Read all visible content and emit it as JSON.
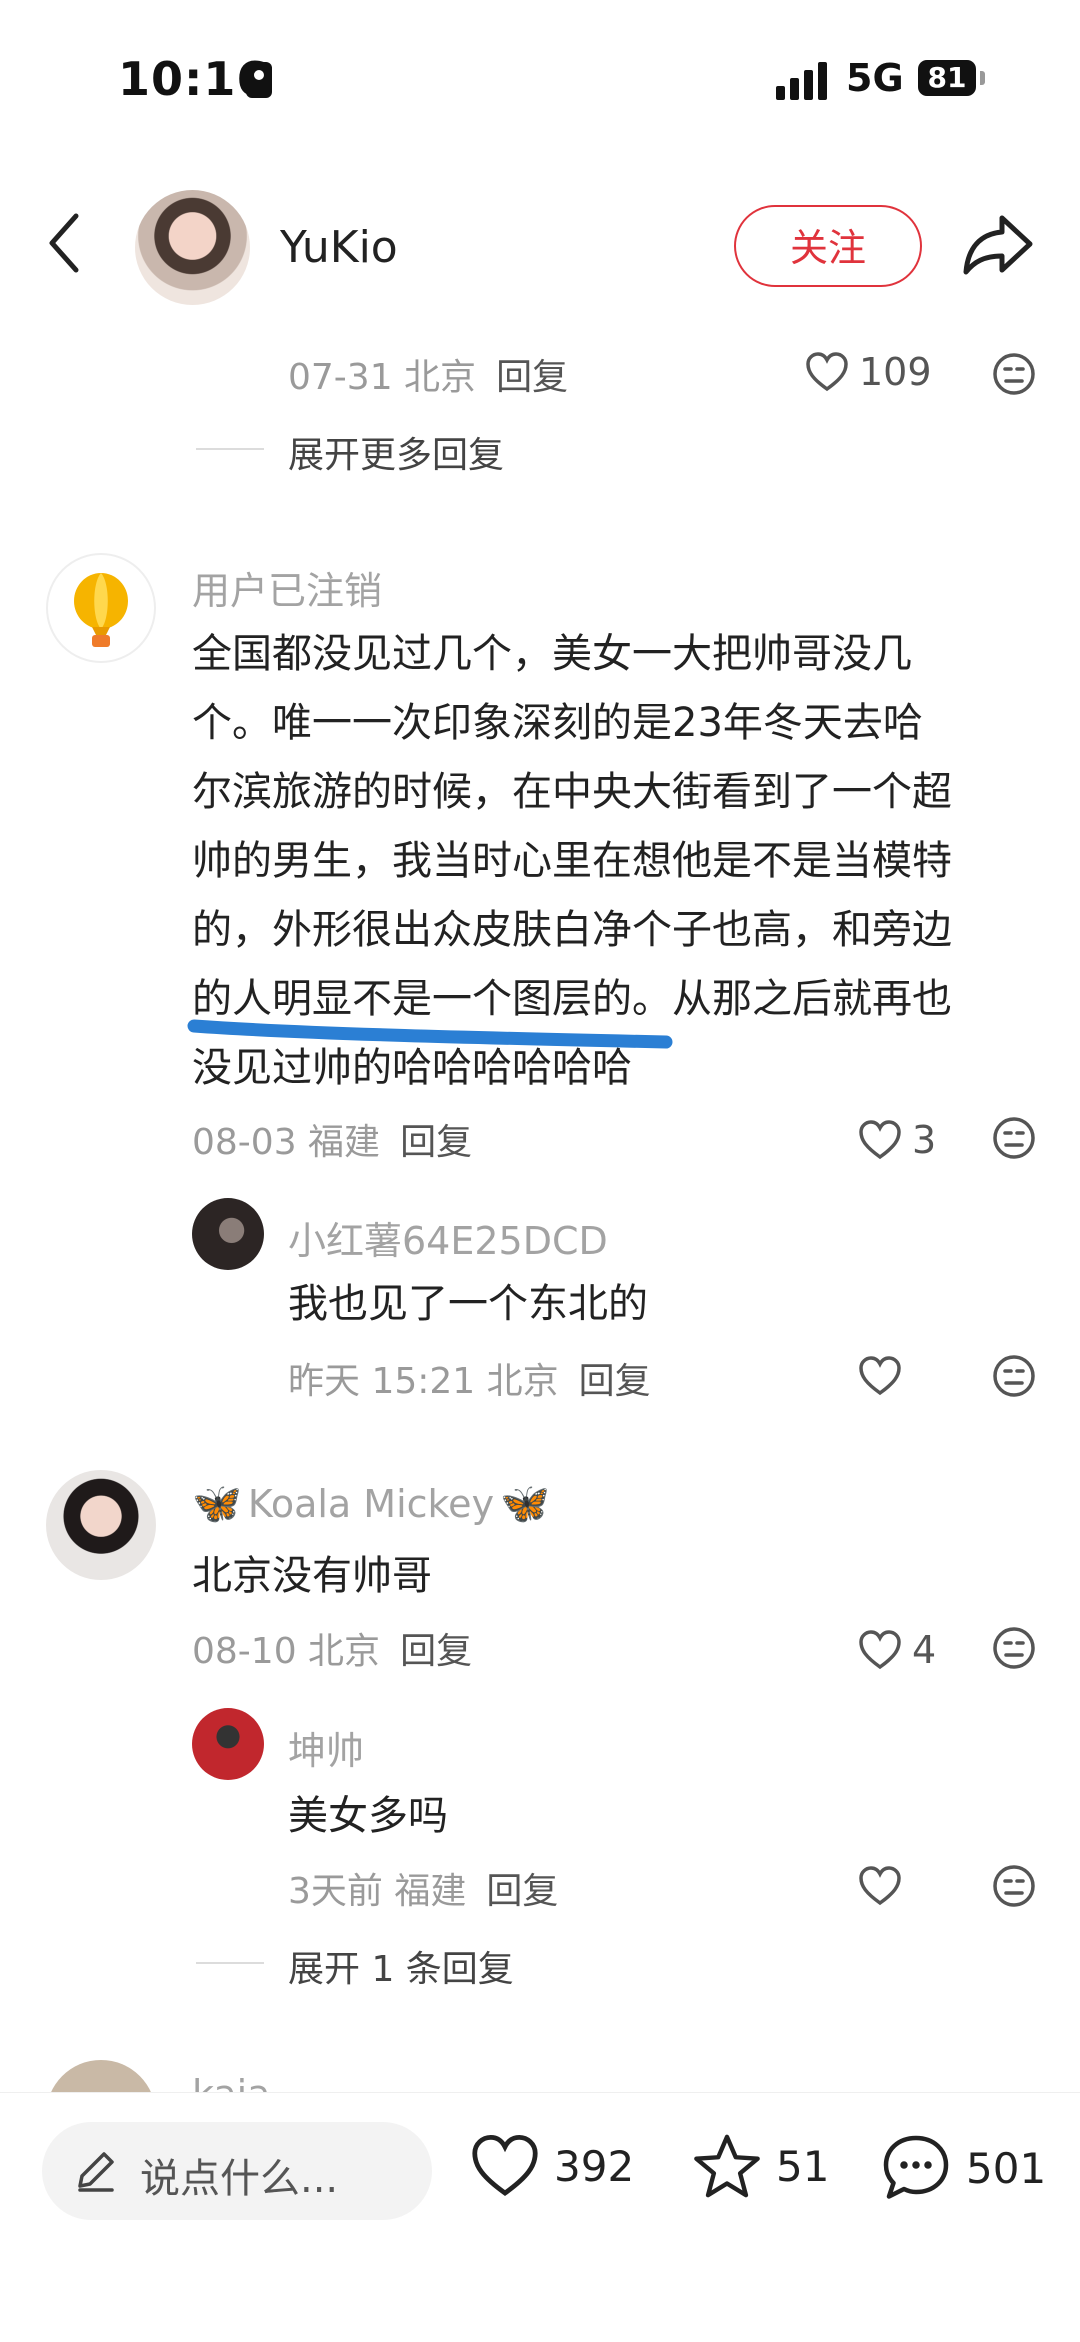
{
  "status_bar": {
    "time": "10:16",
    "network": "5G",
    "battery": "81"
  },
  "header": {
    "author_name": "YuKio",
    "follow_label": "关注"
  },
  "prev_thread": {
    "meta_date_loc": "07-31 北京",
    "reply_label": "回复",
    "likes": "109",
    "expand_label": "展开更多回复"
  },
  "comments": [
    {
      "username": "用户已注销",
      "text_lines": [
        "全国都没见过几个，美女一大把帅哥没几",
        "个。唯一一次印象深刻的是23年冬天去哈",
        "尔滨旅游的时候，在中央大街看到了一个超",
        "帅的男生，我当时心里在想他是不是当模特",
        "的，外形很出众皮肤白净个子也高，和旁边",
        "的人明显不是一个图层的。从那之后就再也",
        "没见过帅的哈哈哈哈哈哈"
      ],
      "meta": "08-03 福建",
      "reply_label": "回复",
      "likes": "3",
      "replies": [
        {
          "username": "小红薯64E25DCD",
          "text": "我也见了一个东北的",
          "meta": "昨天 15:21 北京",
          "reply_label": "回复"
        }
      ]
    },
    {
      "username": "Koala Mickey",
      "username_emoji": "🦋",
      "text": "北京没有帅哥",
      "meta": "08-10 北京",
      "reply_label": "回复",
      "likes": "4",
      "replies": [
        {
          "username": "坤帅",
          "text": "美女多吗",
          "meta": "3天前 福建",
          "reply_label": "回复"
        }
      ],
      "expand_label": "展开 1 条回复"
    },
    {
      "username_partial": "kaia"
    }
  ],
  "bottom_bar": {
    "input_placeholder": "说点什么...",
    "likes": "392",
    "favorites": "51",
    "comments": "501"
  },
  "colors": {
    "accent": "#e0333c",
    "underline": "#2b7fd4"
  }
}
